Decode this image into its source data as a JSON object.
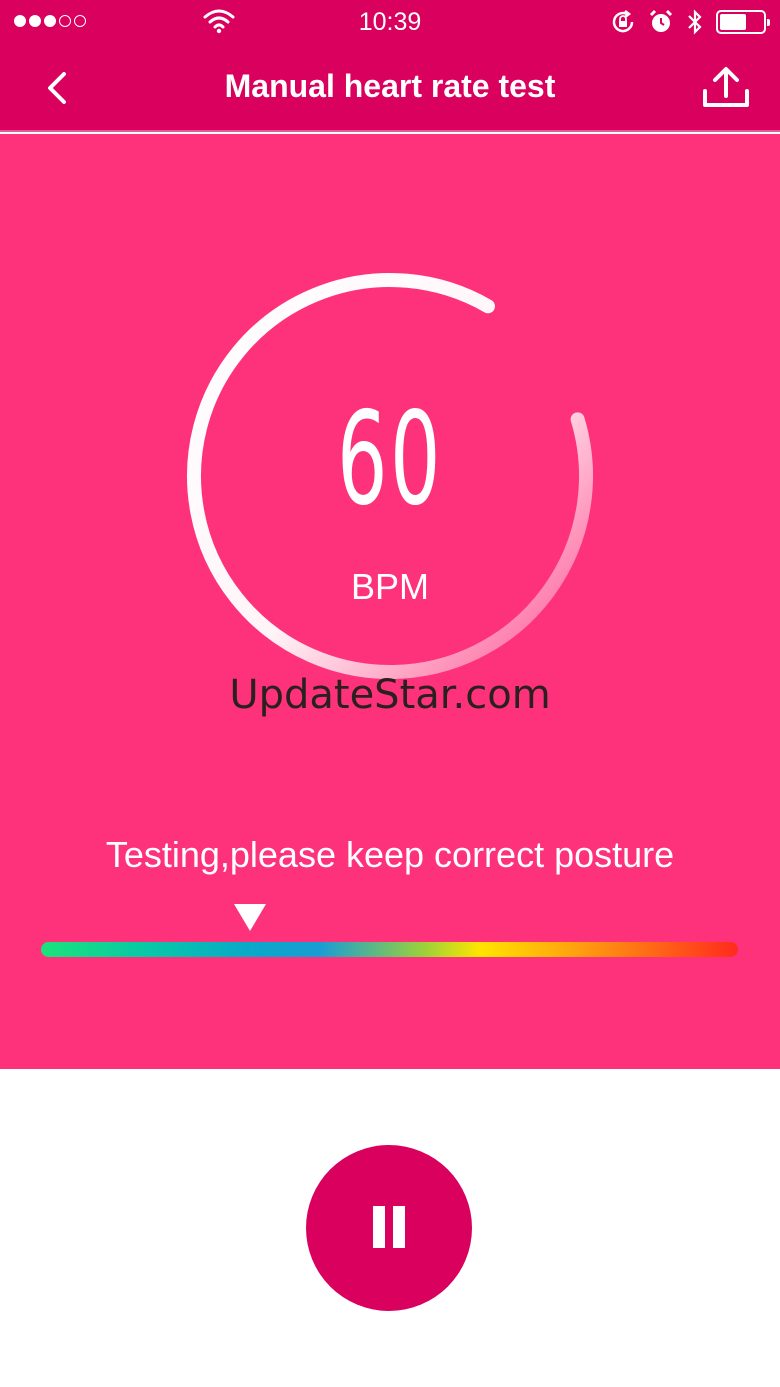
{
  "status_bar": {
    "time": "10:39",
    "signal_dots_filled": 3,
    "signal_dots_total": 5,
    "battery_level": 0.62,
    "icons": [
      "wifi-icon",
      "rotation-lock-icon",
      "alarm-icon",
      "bluetooth-icon",
      "battery-icon"
    ]
  },
  "header": {
    "title": "Manual heart rate test",
    "back_icon": "chevron-left-icon",
    "share_icon": "upload-icon"
  },
  "reading": {
    "value": "60",
    "unit": "BPM",
    "gauge_progress": 0.88
  },
  "watermark": "UpdateStar.com",
  "status_message": "Testing,please keep correct posture",
  "scale": {
    "indicator_position": 0.3
  },
  "controls": {
    "pause_icon": "pause-icon"
  },
  "colors": {
    "header": "#d9005e",
    "background": "#fe327a",
    "button": "#d9005e"
  }
}
